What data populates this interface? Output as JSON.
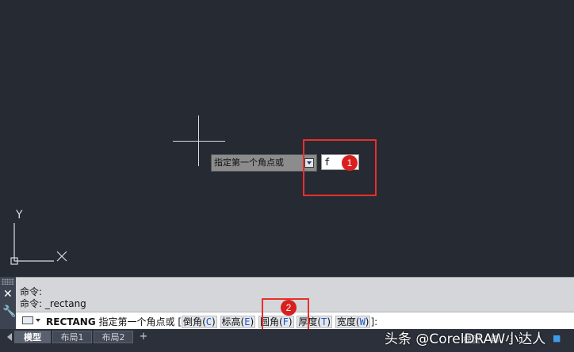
{
  "canvas": {
    "tooltip_label": "指定第一个角点或",
    "input_value": "f",
    "axis_label": "Y"
  },
  "annotations": {
    "badge_1": "1",
    "badge_2": "2"
  },
  "command": {
    "history": [
      "命令:",
      "命令: _rectang"
    ],
    "current_name": "RECTANG",
    "prompt": "指定第一个角点或",
    "options": [
      {
        "label": "倒角",
        "key": "C"
      },
      {
        "label": "标高",
        "key": "E"
      },
      {
        "label": "圆角",
        "key": "F"
      },
      {
        "label": "厚度",
        "key": "T"
      },
      {
        "label": "宽度",
        "key": "W"
      }
    ],
    "open_bracket": "[",
    "close_bracket": "]:"
  },
  "layout_tabs": [
    {
      "label": "模型",
      "active": true
    },
    {
      "label": "布局1",
      "active": false
    },
    {
      "label": "布局2",
      "active": false
    }
  ],
  "add_tab": "+",
  "status_bar": {
    "model_label": "模型"
  },
  "watermark": "头条 @CorelDRAW小达人",
  "colors": {
    "canvas_bg": "#252a33",
    "highlight": "#e8302b",
    "key_blue": "#1a55c9"
  }
}
